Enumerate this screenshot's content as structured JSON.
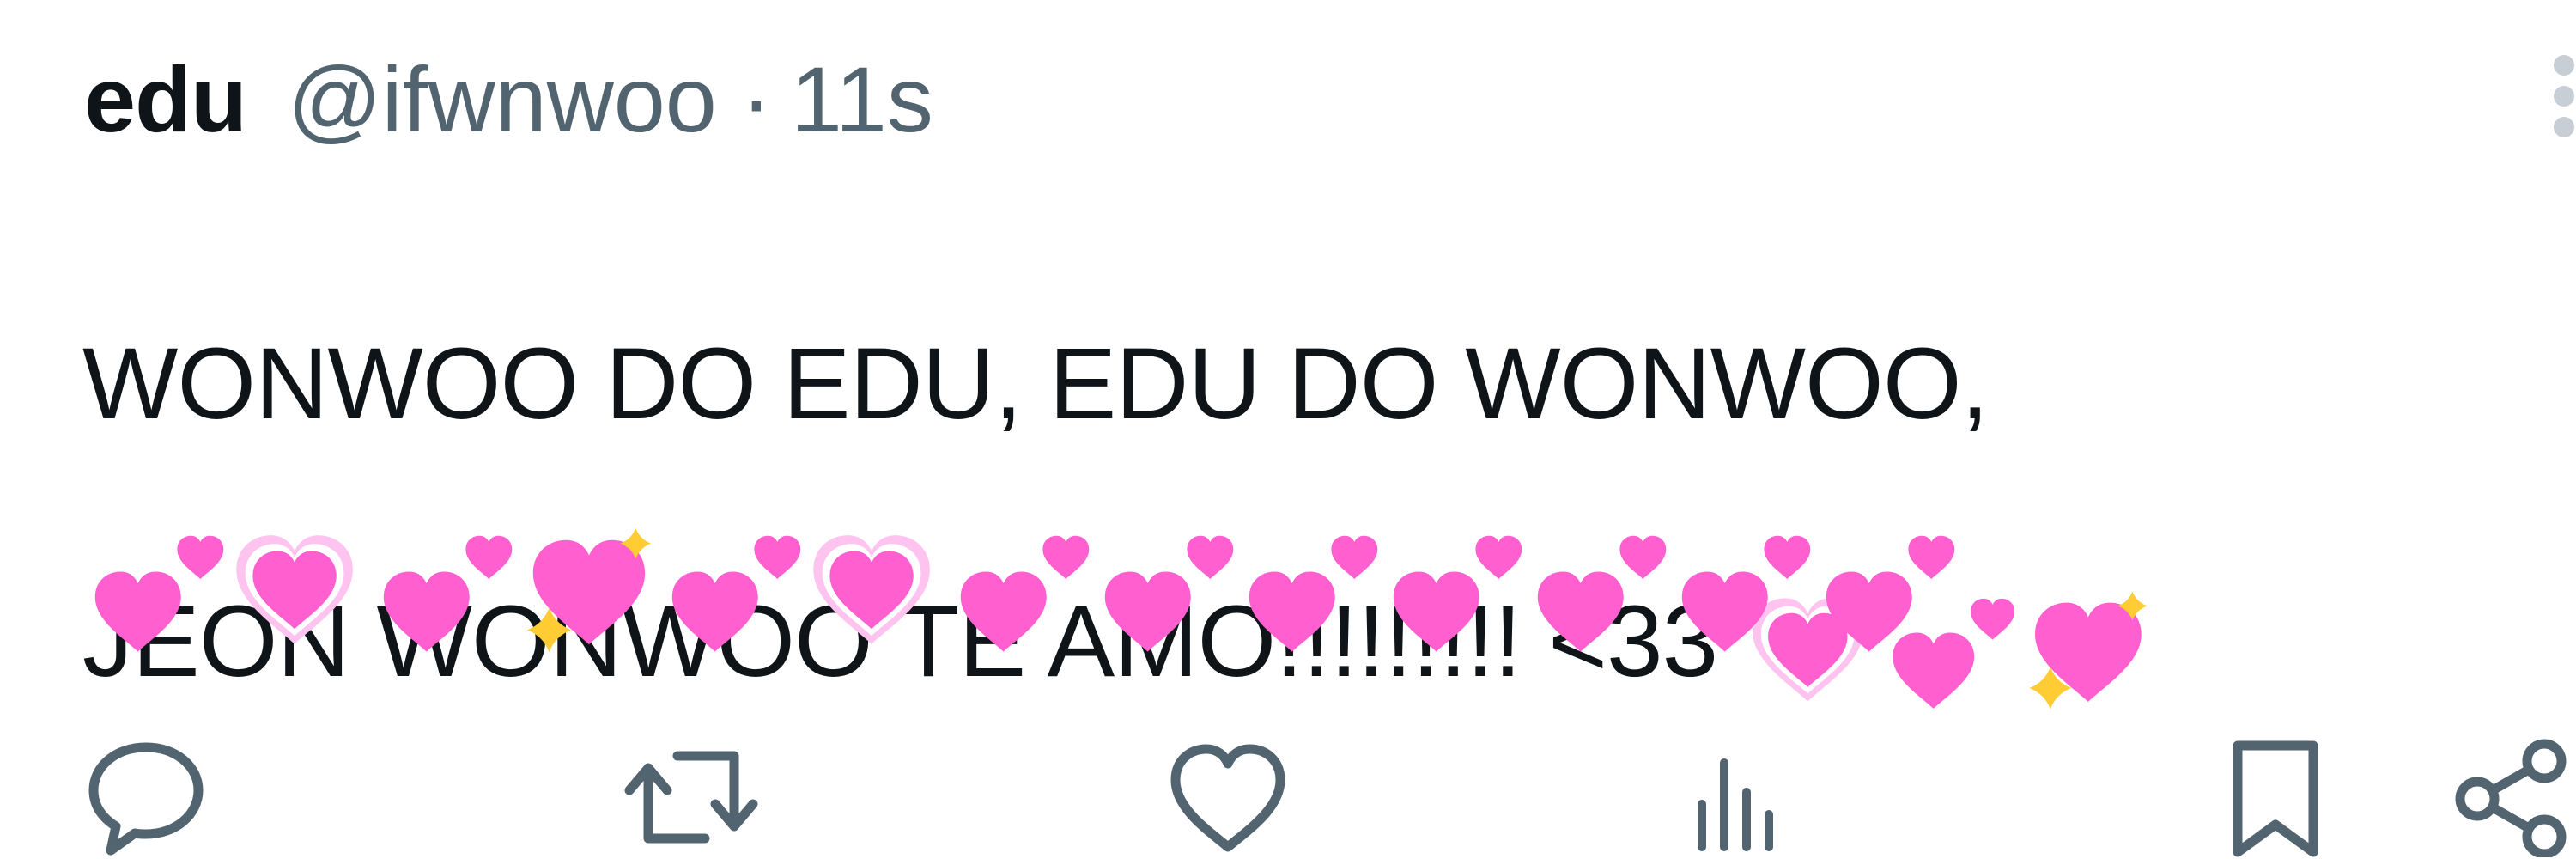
{
  "tweet": {
    "display_name": "edu",
    "handle": "@ifwnwoo",
    "separator": "·",
    "timestamp": "11s",
    "text_line_1": "WONWOO DO EDU, EDU DO WONWOO,",
    "text_line_2": "JEON WONWOO TE AMO!!!!!!!!! <33",
    "inline_emojis": [
      "growing-heart",
      "two-hearts",
      "sparkling-heart"
    ],
    "emoji_row": [
      "two-hearts",
      "growing-heart",
      "two-hearts",
      "sparkling-heart",
      "two-hearts",
      "growing-heart",
      "two-hearts",
      "two-hearts",
      "two-hearts",
      "two-hearts",
      "two-hearts",
      "two-hearts",
      "two-hearts"
    ]
  },
  "actions": {
    "reply_icon": "reply-icon",
    "retweet_icon": "retweet-icon",
    "like_icon": "like-icon",
    "views_icon": "views-icon",
    "bookmark_icon": "bookmark-icon",
    "share_icon": "share-icon"
  },
  "colors": {
    "text": "#0f1419",
    "secondary": "#536471",
    "heart_pink": "#ff5fcf",
    "heart_light": "#ffc3ef",
    "sparkle": "#ffcc33"
  }
}
